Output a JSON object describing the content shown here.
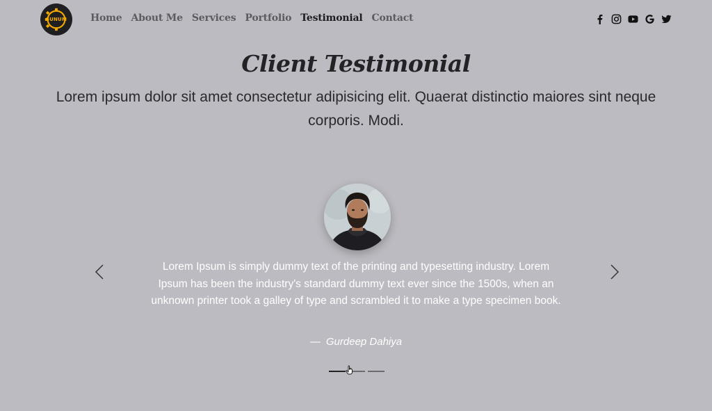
{
  "nav": {
    "logo_text": "SUNUM",
    "links": [
      {
        "label": "Home",
        "active": false
      },
      {
        "label": "About Me",
        "active": false
      },
      {
        "label": "Services",
        "active": false
      },
      {
        "label": "Portfolio",
        "active": false
      },
      {
        "label": "Testimonial",
        "active": true
      },
      {
        "label": "Contact",
        "active": false
      }
    ],
    "social_icons": [
      "facebook-icon",
      "instagram-icon",
      "youtube-icon",
      "google-icon",
      "twitter-icon"
    ]
  },
  "header": {
    "title": "Client Testimonial",
    "subtitle": "Lorem ipsum dolor sit amet consectetur adipisicing elit. Quaerat distinctio maiores sint neque corporis. Modi."
  },
  "testimonial": {
    "quote": "Lorem Ipsum is simply dummy text of the printing and typesetting industry. Lorem Ipsum has been the industry's standard dummy text ever since the 1500s, when an unknown printer took a galley of type and scrambled it to make a type specimen book.",
    "author": "Gurdeep Dahiya",
    "author_prefix": "—",
    "slide_count": 3,
    "active_slide": 1
  },
  "colors": {
    "background": "#bcbbc1",
    "logo_accent": "#f2a900",
    "text_dark": "#232326"
  }
}
